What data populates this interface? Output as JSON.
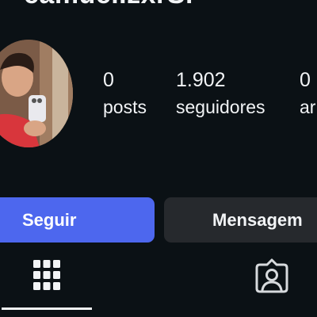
{
  "profile": {
    "username": "camuci.zxrSr"
  },
  "stats": {
    "posts": {
      "value": "0",
      "label": "posts"
    },
    "followers": {
      "value": "1.902",
      "label": "seguidores"
    },
    "following": {
      "value": "0",
      "label": "ar"
    }
  },
  "actions": {
    "follow_label": "Seguir",
    "message_label": "Mensagem"
  },
  "tabs": [
    {
      "icon": "grid-icon",
      "active": true
    },
    {
      "icon": "tagged-person-icon",
      "active": false
    }
  ],
  "colors": {
    "background": "#0b1115",
    "follow_button": "#4d67ee",
    "message_button": "#26292d",
    "text": "#f2f4f6"
  }
}
